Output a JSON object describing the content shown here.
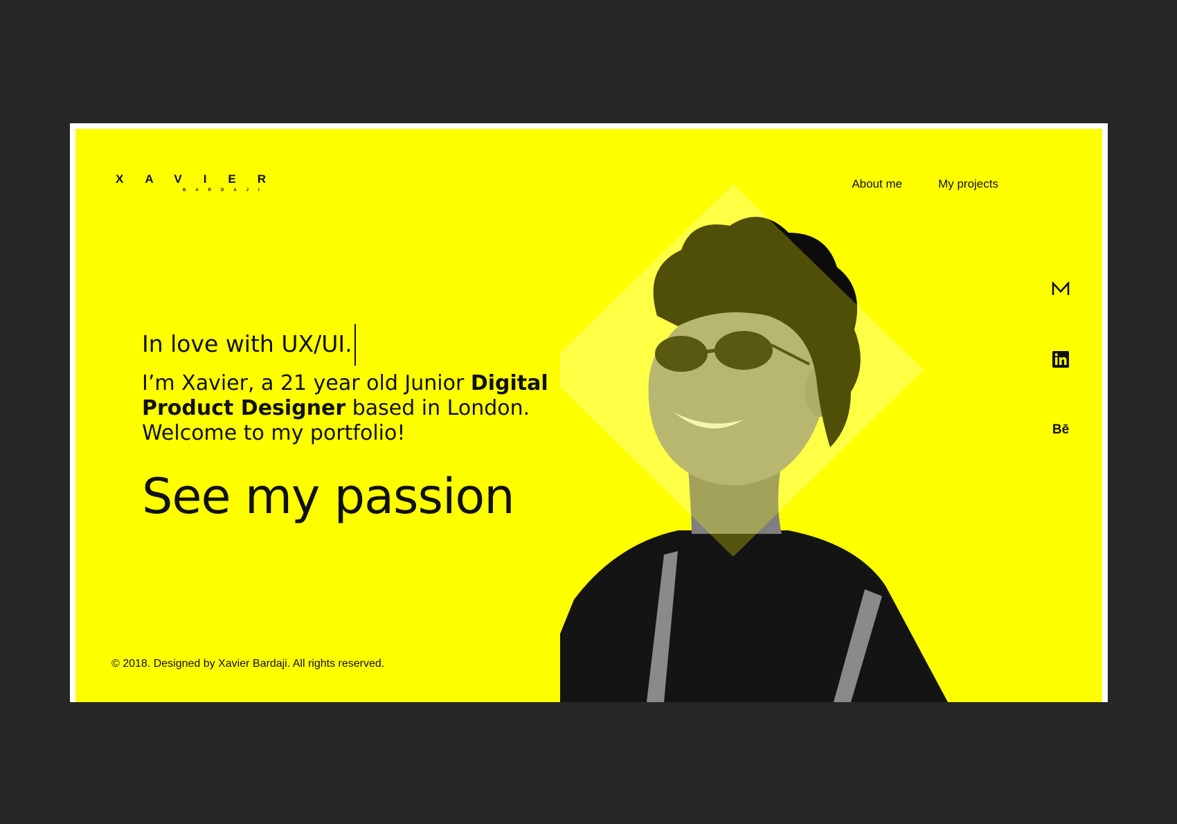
{
  "logo": {
    "name": "XAVIER",
    "surname": "BARDAJI"
  },
  "nav": {
    "about": "About me",
    "projects": "My projects"
  },
  "hero": {
    "tagline": "In love with UX/UI.",
    "intro_1": "I’m Xavier, a 21 year old Junior ",
    "intro_bold": "Digital Product Designer",
    "intro_2": " based in London. Welcome to my portfolio!",
    "headline": "See my passion"
  },
  "social": {
    "medium_icon": "medium-icon",
    "linkedin_icon": "linkedin-icon",
    "behance_label": "Bē"
  },
  "footer": {
    "copyright": "© 2018. Designed by Xavier Bardaji. All rights reserved."
  },
  "colors": {
    "accent": "#ffff00",
    "frame_bg": "#262626",
    "text": "#111111"
  }
}
